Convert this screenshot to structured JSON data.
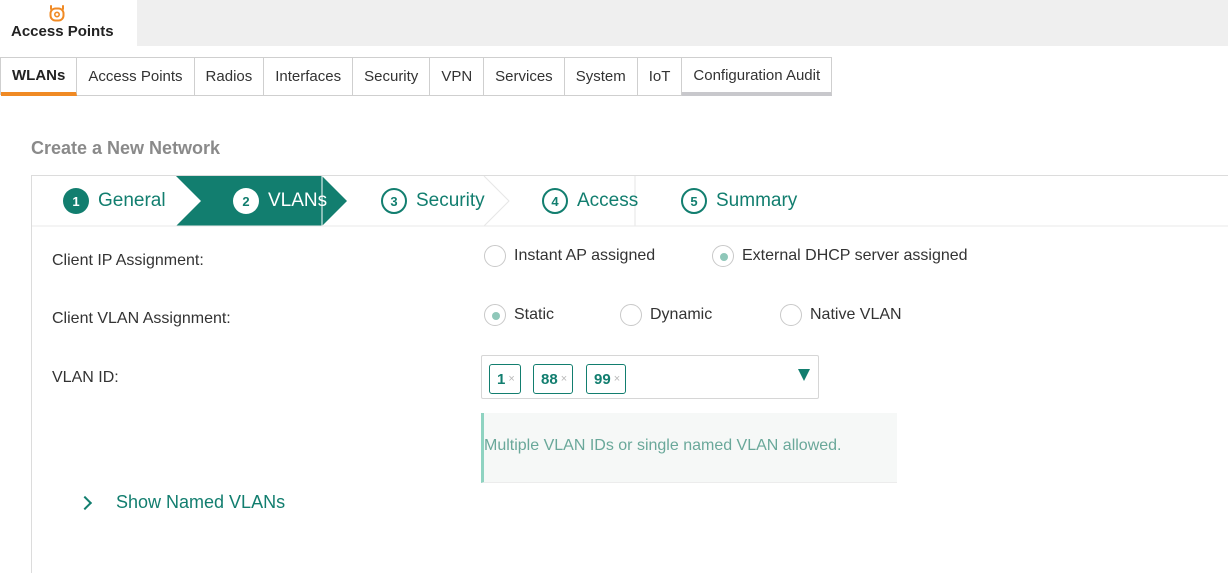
{
  "header": {
    "app_title": "Access Points"
  },
  "tabs": [
    {
      "label": "WLANs",
      "active": true
    },
    {
      "label": "Access Points"
    },
    {
      "label": "Radios"
    },
    {
      "label": "Interfaces"
    },
    {
      "label": "Security"
    },
    {
      "label": "VPN"
    },
    {
      "label": "Services"
    },
    {
      "label": "System"
    },
    {
      "label": "IoT"
    },
    {
      "label": "Configuration Audit"
    }
  ],
  "page_title": "Create a New Network",
  "wizard": {
    "steps": [
      {
        "num": "1",
        "label": "General"
      },
      {
        "num": "2",
        "label": "VLANs",
        "active": true
      },
      {
        "num": "3",
        "label": "Security"
      },
      {
        "num": "4",
        "label": "Access"
      },
      {
        "num": "5",
        "label": "Summary"
      }
    ]
  },
  "form": {
    "client_ip": {
      "label": "Client IP Assignment:",
      "options": [
        {
          "label": "Instant AP assigned",
          "selected": false
        },
        {
          "label": "External DHCP server assigned",
          "selected": true
        }
      ]
    },
    "client_vlan": {
      "label": "Client VLAN Assignment:",
      "options": [
        {
          "label": "Static",
          "selected": true
        },
        {
          "label": "Dynamic",
          "selected": false
        },
        {
          "label": "Native VLAN",
          "selected": false
        }
      ]
    },
    "vlan_id": {
      "label": "VLAN ID:",
      "chips": [
        "1",
        "88",
        "99"
      ],
      "remove_glyph": "×"
    },
    "hint": "Multiple VLAN IDs or single named VLAN allowed.",
    "show_named": "Show Named VLANs"
  },
  "colors": {
    "accent": "#127e6f",
    "tab_active": "#f08a24",
    "hint_bar": "#8fd3c1"
  }
}
